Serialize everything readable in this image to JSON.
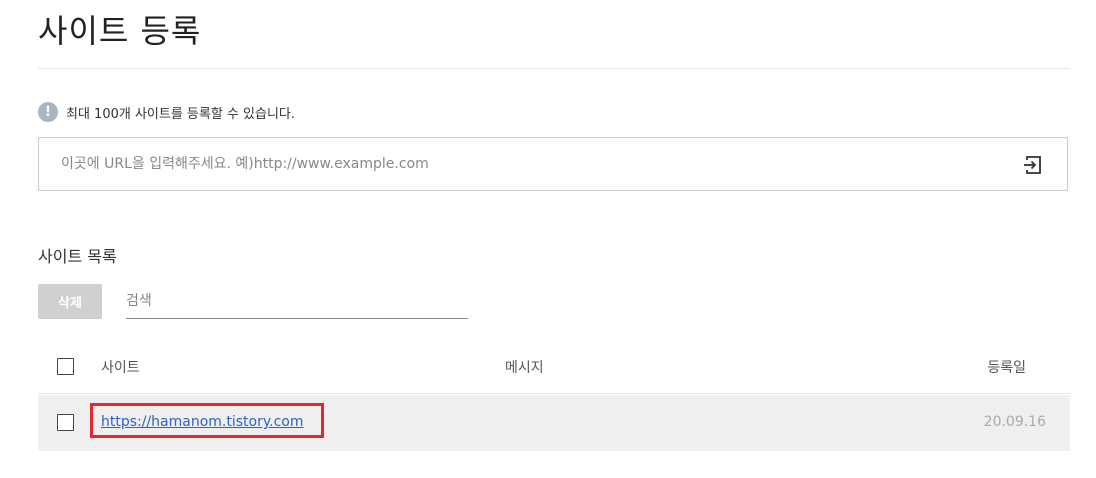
{
  "header": {
    "title": "사이트 등록"
  },
  "notice": {
    "icon": "info-icon",
    "icon_glyph": "!",
    "text": "최대 100개 사이트를 등록할 수 있습니다."
  },
  "url_input": {
    "value": "",
    "placeholder": "이곳에 URL을 입력해주세요. 예)http://www.example.com",
    "submit_icon": "enter-icon"
  },
  "site_list": {
    "title": "사이트 목록",
    "delete_label": "삭제",
    "search_placeholder": "검색",
    "columns": {
      "select": "",
      "site": "사이트",
      "message": "메시지",
      "date": "등록일"
    },
    "rows": [
      {
        "checked": false,
        "site": "https://hamanom.tistory.com",
        "message": "",
        "date": "20.09.16",
        "highlighted": true
      }
    ]
  },
  "colors": {
    "highlight": "#e3262f",
    "link": "#2a64c8",
    "disabled_button": "#d0d0d0",
    "row_background": "#efefef"
  }
}
